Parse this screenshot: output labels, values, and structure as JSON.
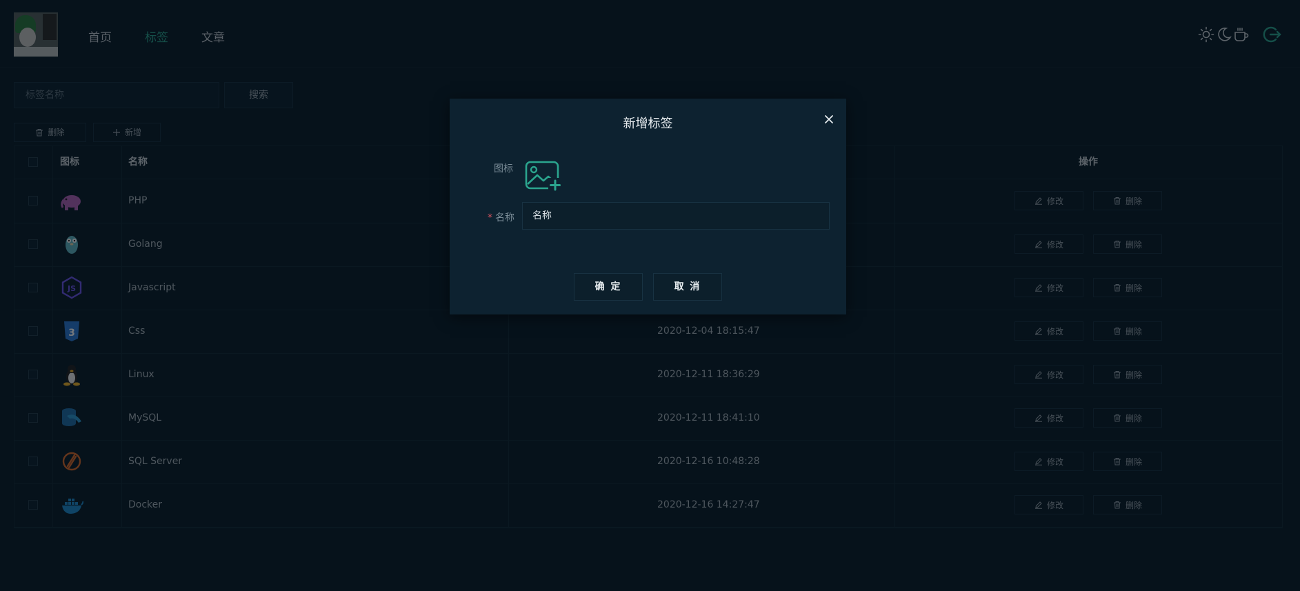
{
  "header": {
    "nav": [
      {
        "label": "首页"
      },
      {
        "label": "标签"
      },
      {
        "label": "文章"
      }
    ],
    "active_color": "#2ba58e",
    "icons": [
      "sun-icon",
      "moon-icon",
      "coffee-icon",
      "logout-icon"
    ]
  },
  "search": {
    "placeholder": "标签名称",
    "button_label": "搜索"
  },
  "toolbar": {
    "delete_label": "删除",
    "add_label": "新增"
  },
  "table": {
    "columns": [
      "图标",
      "名称",
      "操作"
    ],
    "edit_label": "修改",
    "delete_label": "删除",
    "rows": [
      {
        "icon": "php-elephant-icon",
        "name": "PHP",
        "time": ""
      },
      {
        "icon": "golang-gopher-icon",
        "name": "Golang",
        "time": ""
      },
      {
        "icon": "javascript-icon",
        "name": "Javascript",
        "time": ""
      },
      {
        "icon": "css3-icon",
        "name": "Css",
        "time": "2020-12-04 18:15:47"
      },
      {
        "icon": "linux-tux-icon",
        "name": "Linux",
        "time": "2020-12-11 18:36:29"
      },
      {
        "icon": "mysql-icon",
        "name": "MySQL",
        "time": "2020-12-11 18:41:10"
      },
      {
        "icon": "sql-server-icon",
        "name": "SQL Server",
        "time": "2020-12-16 10:48:28"
      },
      {
        "icon": "docker-icon",
        "name": "Docker",
        "time": "2020-12-16 14:27:47"
      }
    ]
  },
  "modal": {
    "title": "新增标签",
    "icon_label": "图标",
    "name_label": "名称",
    "name_placeholder": "名称",
    "confirm_label": "确 定",
    "cancel_label": "取 消"
  }
}
